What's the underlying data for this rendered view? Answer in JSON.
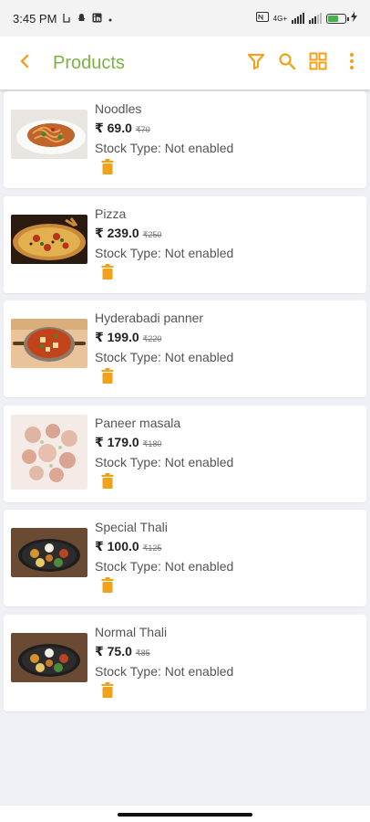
{
  "status_bar": {
    "time": "3:45 PM",
    "notif_icons": [
      "sync-icon",
      "snapchat-icon",
      "linkedin-icon",
      "dot-icon"
    ],
    "network": "4G+",
    "battery": "70%"
  },
  "app_bar": {
    "title": "Products",
    "accent": "#f0a21a",
    "title_color": "#7cb342"
  },
  "products": [
    {
      "name": "Noodles",
      "price": "₹ 69.0",
      "mrp": "₹70",
      "stock": "Stock Type: Not enabled",
      "image": "noodles-image"
    },
    {
      "name": "Pizza",
      "price": "₹ 239.0",
      "mrp": "₹250",
      "stock": "Stock Type: Not enabled",
      "image": "pizza-image"
    },
    {
      "name": "Hyderabadi panner",
      "price": "₹ 199.0",
      "mrp": "₹220",
      "stock": "Stock Type: Not enabled",
      "image": "hyderabadi-panner-image"
    },
    {
      "name": "Paneer masala",
      "price": "₹ 179.0",
      "mrp": "₹180",
      "stock": "Stock Type: Not enabled",
      "image": "paneer-masala-image"
    },
    {
      "name": "Special Thali",
      "price": "₹ 100.0",
      "mrp": "₹125",
      "stock": "Stock Type: Not enabled",
      "image": "special-thali-image"
    },
    {
      "name": "Normal Thali",
      "price": "₹ 75.0",
      "mrp": "₹85",
      "stock": "Stock Type: Not enabled",
      "image": "normal-thali-image"
    }
  ]
}
